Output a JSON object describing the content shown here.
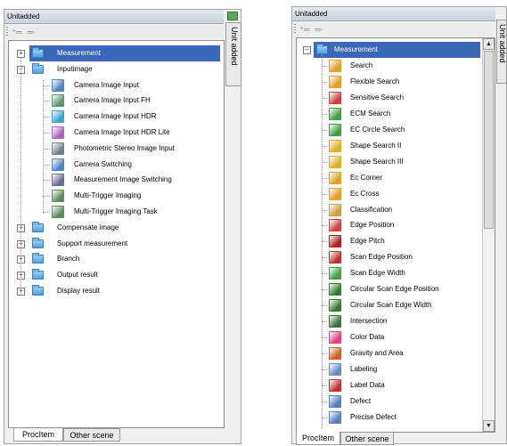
{
  "left_panel": {
    "title": "Unitadded",
    "side_tab": "Unit added",
    "toolbar": {
      "add_icon": "add-unit-icon",
      "remove_icon": "remove-unit-icon"
    },
    "tree": [
      {
        "label": "Measurement",
        "expander": "+",
        "type": "folder",
        "selected": true
      },
      {
        "label": "Inputimage",
        "expander": "−",
        "type": "folder"
      },
      {
        "label": "Camera Image Input",
        "type": "item",
        "icon": "camera-icon"
      },
      {
        "label": "Camera Image Input FH",
        "type": "item",
        "icon": "camera-fh-icon"
      },
      {
        "label": "Camera Image Input HDR",
        "type": "item",
        "icon": "camera-hdr-icon"
      },
      {
        "label": "Camera Image Input HDR Lite",
        "type": "item",
        "icon": "camera-hdr-lite-icon"
      },
      {
        "label": "Photometric Stereo Image Input",
        "type": "item",
        "icon": "photometric-stereo-icon"
      },
      {
        "label": "Camera Switching",
        "type": "item",
        "icon": "camera-switching-icon"
      },
      {
        "label": "Measurement Image Switching",
        "type": "item",
        "icon": "image-switching-icon"
      },
      {
        "label": "Multi-Trigger Imaging",
        "type": "item",
        "icon": "multi-trigger-icon"
      },
      {
        "label": "Multi-Trigger Imaging Task",
        "type": "item",
        "icon": "multi-trigger-task-icon"
      },
      {
        "label": "Compensate image",
        "expander": "+",
        "type": "folder"
      },
      {
        "label": "Support measurement",
        "expander": "+",
        "type": "folder"
      },
      {
        "label": "Branch",
        "expander": "+",
        "type": "folder"
      },
      {
        "label": "Output result",
        "expander": "+",
        "type": "folder"
      },
      {
        "label": "Display result",
        "expander": "+",
        "type": "folder"
      }
    ],
    "tabs": [
      "ProcItem",
      "Other scene"
    ]
  },
  "right_panel": {
    "title": "Unitadded",
    "side_tab": "Unit added",
    "toolbar": {
      "add_icon": "add-unit-icon",
      "remove_icon": "remove-unit-icon"
    },
    "tree": [
      {
        "label": "Measurement",
        "expander": "−",
        "type": "folder",
        "selected": true
      },
      {
        "label": "Search",
        "type": "item",
        "icon": "search-icon"
      },
      {
        "label": "Flexible Search",
        "type": "item",
        "icon": "flexible-search-icon"
      },
      {
        "label": "Sensitive Search",
        "type": "item",
        "icon": "sensitive-search-icon"
      },
      {
        "label": "ECM Search",
        "type": "item",
        "icon": "ecm-search-icon"
      },
      {
        "label": "EC Circle Search",
        "type": "item",
        "icon": "ec-circle-search-icon"
      },
      {
        "label": "Shape Search II",
        "type": "item",
        "icon": "shape-search-2-icon"
      },
      {
        "label": "Shape Search III",
        "type": "item",
        "icon": "shape-search-3-icon"
      },
      {
        "label": "Ec Corner",
        "type": "item",
        "icon": "ec-corner-icon"
      },
      {
        "label": "Ec Cross",
        "type": "item",
        "icon": "ec-cross-icon"
      },
      {
        "label": "Classification",
        "type": "item",
        "icon": "classification-icon"
      },
      {
        "label": "Edge Position",
        "type": "item",
        "icon": "edge-position-icon"
      },
      {
        "label": "Edge Pitch",
        "type": "item",
        "icon": "edge-pitch-icon"
      },
      {
        "label": "Scan Edge Position",
        "type": "item",
        "icon": "scan-edge-position-icon"
      },
      {
        "label": "Scan Edge Width",
        "type": "item",
        "icon": "scan-edge-width-icon"
      },
      {
        "label": "Circular Scan Edge Position",
        "type": "item",
        "icon": "circular-scan-edge-position-icon"
      },
      {
        "label": "Circular Scan Edge Width",
        "type": "item",
        "icon": "circular-scan-edge-width-icon"
      },
      {
        "label": "Intersection",
        "type": "item",
        "icon": "intersection-icon"
      },
      {
        "label": "Color Data",
        "type": "item",
        "icon": "color-data-icon"
      },
      {
        "label": "Gravity and Area",
        "type": "item",
        "icon": "gravity-area-icon"
      },
      {
        "label": "Labeling",
        "type": "item",
        "icon": "labeling-icon"
      },
      {
        "label": "Label Data",
        "type": "item",
        "icon": "label-data-icon"
      },
      {
        "label": "Defect",
        "type": "item",
        "icon": "defect-icon"
      },
      {
        "label": "Precise Defect",
        "type": "item",
        "icon": "precise-defect-icon"
      }
    ],
    "tabs": [
      "ProcItem",
      "Other scene"
    ]
  },
  "icon_colors": {
    "camera-icon": "#4a86c8",
    "camera-fh-icon": "#5a9a6a",
    "camera-hdr-icon": "#3aa0d0",
    "camera-hdr-lite-icon": "#b060c0",
    "photometric-stereo-icon": "#708090",
    "camera-switching-icon": "#4a86c8",
    "image-switching-icon": "#6a6a9a",
    "multi-trigger-icon": "#5a8a5a",
    "multi-trigger-task-icon": "#5a8a5a",
    "search-icon": "#e0a020",
    "flexible-search-icon": "#e0a020",
    "sensitive-search-icon": "#d04040",
    "ecm-search-icon": "#40a040",
    "ec-circle-search-icon": "#40a040",
    "shape-search-2-icon": "#e0b020",
    "shape-search-3-icon": "#e0b020",
    "ec-corner-icon": "#e0a020",
    "ec-cross-icon": "#e0a020",
    "classification-icon": "#d0a040",
    "edge-position-icon": "#d04040",
    "edge-pitch-icon": "#b02020",
    "scan-edge-position-icon": "#c03030",
    "scan-edge-width-icon": "#40a040",
    "circular-scan-edge-position-icon": "#308030",
    "circular-scan-edge-width-icon": "#308030",
    "intersection-icon": "#407040",
    "color-data-icon": "#e04080",
    "gravity-area-icon": "#d06020",
    "labeling-icon": "#6090c0",
    "label-data-icon": "#c03030",
    "defect-icon": "#5080c0",
    "precise-defect-icon": "#5080c0"
  }
}
